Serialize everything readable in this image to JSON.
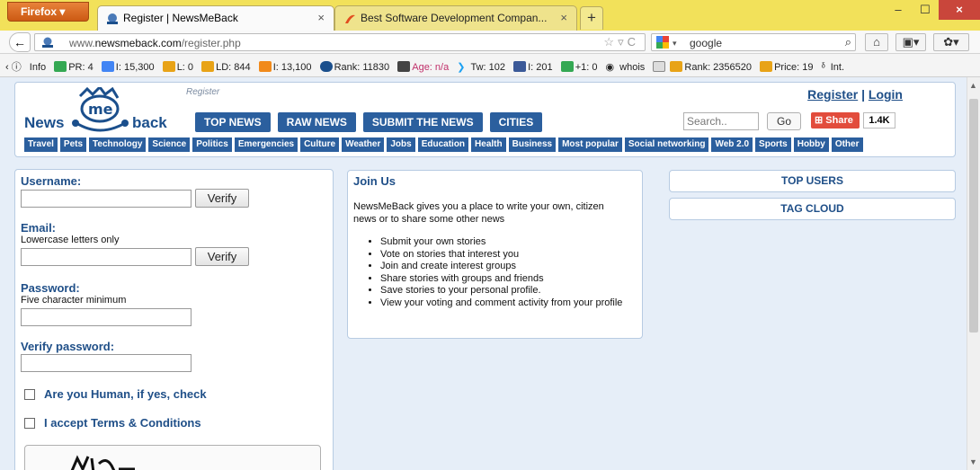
{
  "browser": {
    "app_button": "Firefox",
    "tabs": [
      {
        "label": "Register | NewsMeBack",
        "active": true
      },
      {
        "label": "Best Software Development Compan...",
        "active": false
      }
    ],
    "url_prefix": "www.",
    "url_domain": "newsmeback.com",
    "url_path": "/register.php",
    "search_engine_text": "google",
    "new_tab_symbol": "+",
    "win_buttons": [
      "–",
      "☐",
      "×"
    ]
  },
  "seo_toolbar": {
    "items": [
      "Info",
      "PR: 4",
      "I: 15,300",
      "L: 0",
      "LD: 844",
      "I: 13,100",
      "Rank: 11830",
      "Age: n/a",
      "Tw: 102",
      "I: 201",
      "+1: 0",
      "whois",
      "Rank: 2356520",
      "Price: 19",
      "Int."
    ]
  },
  "site": {
    "logo_left": "News",
    "logo_me": "me",
    "logo_right": "back",
    "page_label": "Register",
    "register_link": "Register",
    "separator": "|",
    "login_link": "Login",
    "main_nav": [
      "TOP NEWS",
      "RAW NEWS",
      "SUBMIT THE NEWS",
      "CITIES"
    ],
    "search_placeholder": "Search..",
    "go_label": "Go",
    "share_label": "Share",
    "share_count": "1.4K",
    "categories": [
      "Travel",
      "Pets",
      "Technology",
      "Science",
      "Politics",
      "Emergencies",
      "Culture",
      "Weather",
      "Jobs",
      "Education",
      "Health",
      "Business",
      "Most popular",
      "Social networking",
      "Web 2.0",
      "Sports",
      "Hobby",
      "Other"
    ]
  },
  "form": {
    "username_label": "Username:",
    "email_label": "Email:",
    "email_hint": "Lowercase letters only",
    "password_label": "Password:",
    "password_hint": "Five character minimum",
    "verify_password_label": "Verify password:",
    "verify_button": "Verify",
    "human_check": "Are you Human, if yes, check",
    "terms_check": "I accept Terms & Conditions"
  },
  "join": {
    "title": "Join Us",
    "intro": "NewsMeBack gives you a place to write your own, citizen news or to share some other news",
    "items": [
      "Submit your own stories",
      "Vote on stories that interest you",
      "Join and create interest groups",
      "Share stories with groups and friends",
      "Save stories to your personal profile.",
      "View your voting and comment activity from your profile"
    ]
  },
  "sidebar": {
    "top_users": "TOP USERS",
    "tag_cloud": "TAG CLOUD"
  },
  "colors": {
    "nav_blue": "#2b5f9e",
    "link_blue": "#1f4f88",
    "page_bg": "#e6eef8",
    "titlebar": "#f2e15a",
    "share_red": "#e24c3c"
  }
}
